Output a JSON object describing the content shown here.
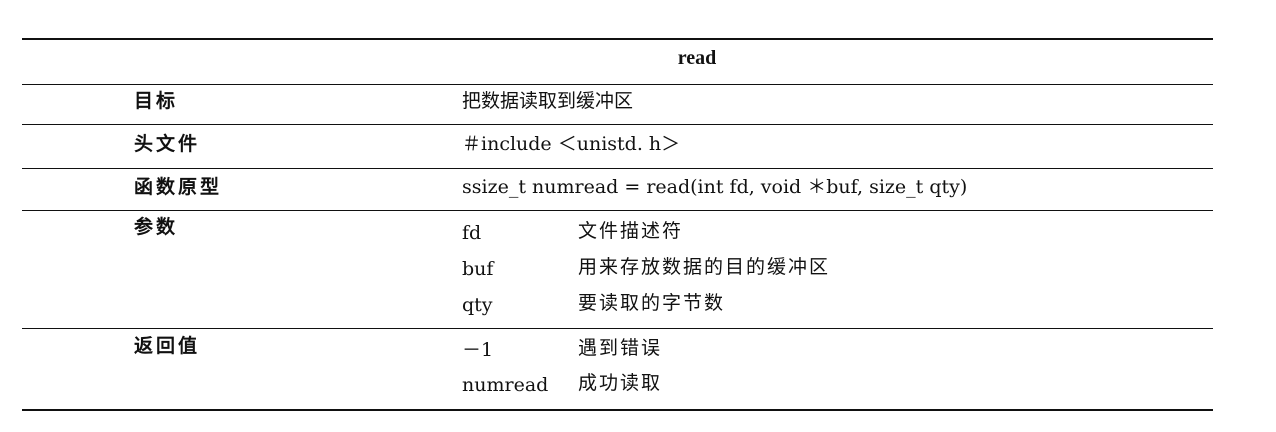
{
  "table": {
    "title": "read",
    "goal": {
      "label": "目标",
      "value": "把数据读取到缓冲区"
    },
    "header_file": {
      "label": "头文件",
      "value": "＃include ＜unistd. h＞"
    },
    "prototype": {
      "label": "函数原型",
      "value": "ssize_t numread = read(int fd, void ＊buf, size_t qty)"
    },
    "params": {
      "label": "参数",
      "items": [
        {
          "name": "fd",
          "desc": "文件描述符"
        },
        {
          "name": "buf",
          "desc": "用来存放数据的目的缓冲区"
        },
        {
          "name": "qty",
          "desc": "要读取的字节数"
        }
      ]
    },
    "return_value": {
      "label": "返回值",
      "items": [
        {
          "name": "－1",
          "desc": "遇到错误"
        },
        {
          "name": "numread",
          "desc": "成功读取"
        }
      ]
    }
  }
}
